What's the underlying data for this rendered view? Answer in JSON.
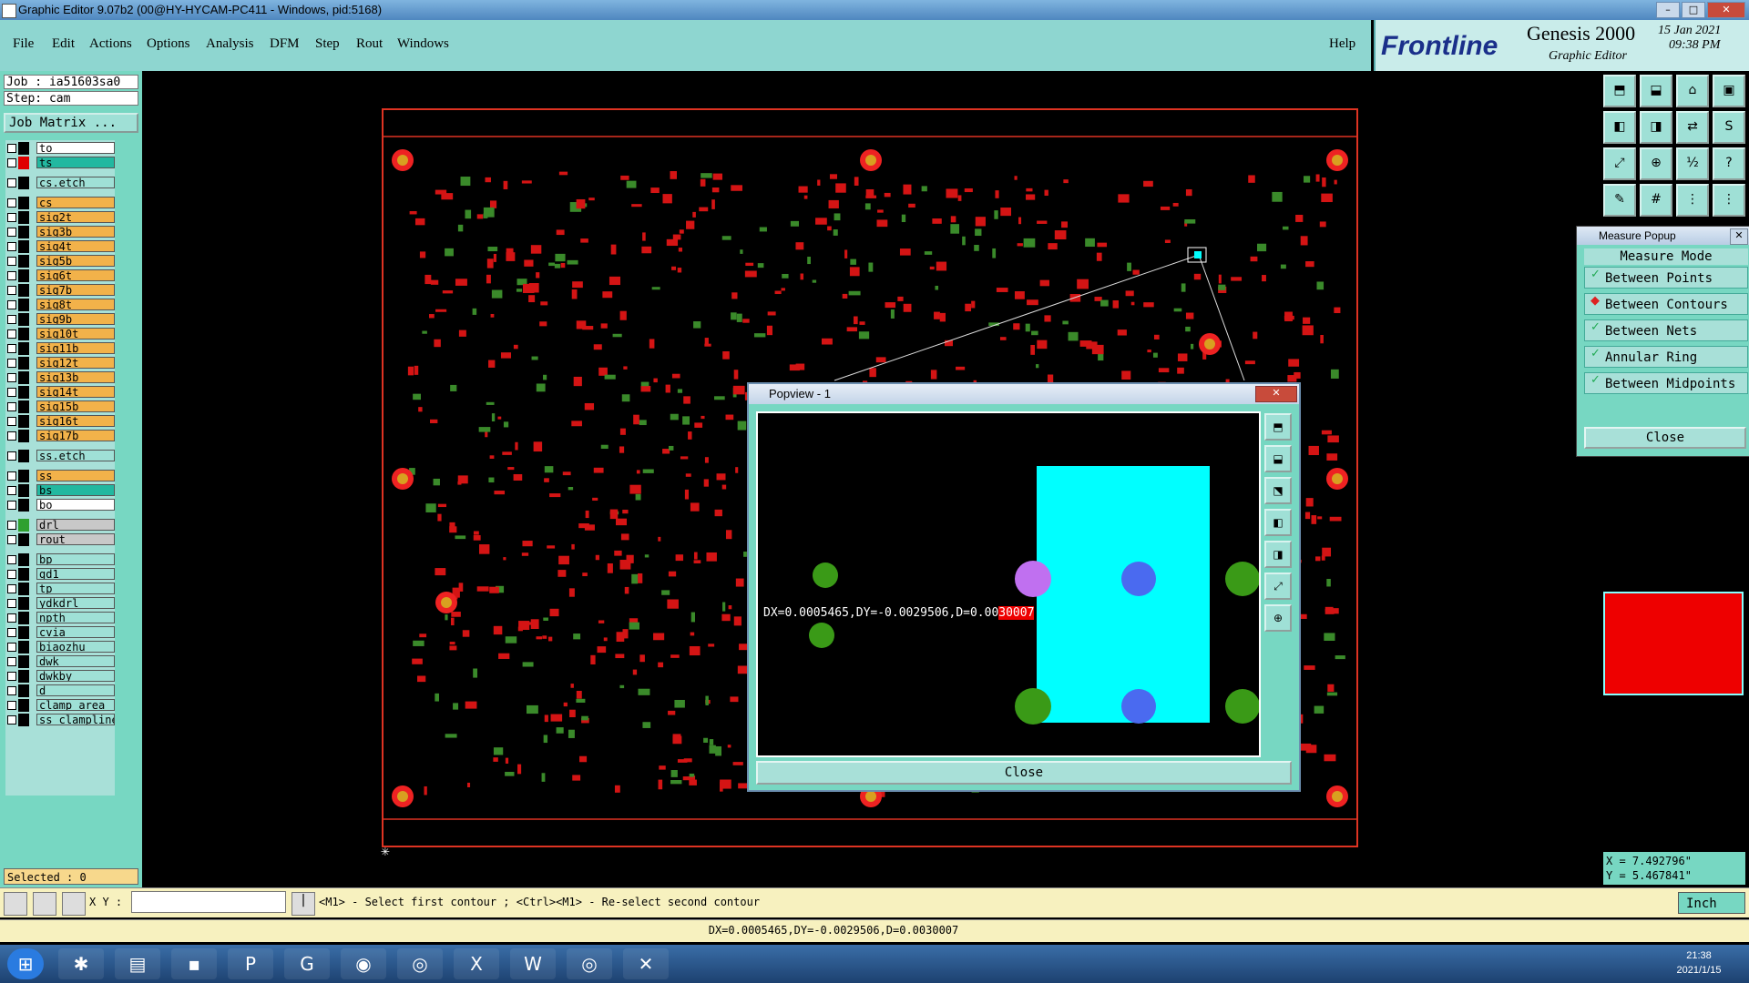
{
  "window": {
    "title": "Graphic Editor 9.07b2 (00@HY-HYCAM-PC411 - Windows, pid:5168)"
  },
  "menu": {
    "items": [
      "File",
      "Edit",
      "Actions",
      "Options",
      "Analysis",
      "DFM",
      "Step",
      "Rout",
      "Windows"
    ],
    "help": "Help"
  },
  "brand": {
    "logo": "Frontline",
    "product": "Genesis 2000",
    "subtitle": "Graphic Editor",
    "date": "15 Jan 2021",
    "time": "09:38 PM"
  },
  "job": {
    "job_line": "Job : ia51603sa0",
    "step_line": "Step: cam",
    "matrix_button": "Job Matrix ..."
  },
  "layers": [
    {
      "name": "to",
      "color": "#ffffff",
      "swatch": "#000000"
    },
    {
      "name": "ts",
      "color": "#22b8a0",
      "swatch": "#e00000"
    },
    {
      "name": "cs.etch",
      "color": "#9fe0d6",
      "swatch": "#000000"
    },
    {
      "name": "cs",
      "color": "#f2b24a",
      "swatch": "#000000"
    },
    {
      "name": "sig2t",
      "color": "#f2b24a",
      "swatch": "#000000"
    },
    {
      "name": "sig3b",
      "color": "#f2b24a",
      "swatch": "#000000"
    },
    {
      "name": "sig4t",
      "color": "#f2b24a",
      "swatch": "#000000"
    },
    {
      "name": "sig5b",
      "color": "#f2b24a",
      "swatch": "#000000"
    },
    {
      "name": "sig6t",
      "color": "#f2b24a",
      "swatch": "#000000"
    },
    {
      "name": "sig7b",
      "color": "#f2b24a",
      "swatch": "#000000"
    },
    {
      "name": "sig8t",
      "color": "#f2b24a",
      "swatch": "#000000"
    },
    {
      "name": "sig9b",
      "color": "#f2b24a",
      "swatch": "#000000"
    },
    {
      "name": "sig10t",
      "color": "#f2b24a",
      "swatch": "#000000"
    },
    {
      "name": "sig11b",
      "color": "#f2b24a",
      "swatch": "#000000"
    },
    {
      "name": "sig12t",
      "color": "#f2b24a",
      "swatch": "#000000"
    },
    {
      "name": "sig13b",
      "color": "#f2b24a",
      "swatch": "#000000"
    },
    {
      "name": "sig14t",
      "color": "#f2b24a",
      "swatch": "#000000"
    },
    {
      "name": "sig15b",
      "color": "#f2b24a",
      "swatch": "#000000"
    },
    {
      "name": "sig16t",
      "color": "#f2b24a",
      "swatch": "#000000"
    },
    {
      "name": "sig17b",
      "color": "#f2b24a",
      "swatch": "#000000"
    },
    {
      "name": "ss.etch",
      "color": "#9fe0d6",
      "swatch": "#000000"
    },
    {
      "name": "ss",
      "color": "#f2b24a",
      "swatch": "#000000"
    },
    {
      "name": "bs",
      "color": "#22b8a0",
      "swatch": "#000000"
    },
    {
      "name": "bo",
      "color": "#ffffff",
      "swatch": "#000000"
    },
    {
      "name": "drl",
      "color": "#c8c8c8",
      "swatch": "#2fa02f"
    },
    {
      "name": "rout",
      "color": "#c8c8c8",
      "swatch": "#000000"
    },
    {
      "name": "bp",
      "color": "#9fe0d6",
      "swatch": "#000000"
    },
    {
      "name": "gd1",
      "color": "#9fe0d6",
      "swatch": "#000000"
    },
    {
      "name": "tp",
      "color": "#9fe0d6",
      "swatch": "#000000"
    },
    {
      "name": "ydkdrl",
      "color": "#9fe0d6",
      "swatch": "#000000"
    },
    {
      "name": "npth",
      "color": "#9fe0d6",
      "swatch": "#000000"
    },
    {
      "name": "cvia",
      "color": "#9fe0d6",
      "swatch": "#000000"
    },
    {
      "name": "biaozhu",
      "color": "#9fe0d6",
      "swatch": "#000000"
    },
    {
      "name": "dwk",
      "color": "#9fe0d6",
      "swatch": "#000000"
    },
    {
      "name": "dwkby",
      "color": "#9fe0d6",
      "swatch": "#000000"
    },
    {
      "name": "d",
      "color": "#9fe0d6",
      "swatch": "#000000"
    },
    {
      "name": "clamp_area",
      "color": "#9fe0d6",
      "swatch": "#000000"
    },
    {
      "name": "ss_clampline",
      "color": "#9fe0d6",
      "swatch": "#000000"
    }
  ],
  "selected": "Selected : 0",
  "measure": {
    "title": "Measure Popup",
    "mode_label": "Measure Mode",
    "options": [
      "Between Points",
      "Between Contours",
      "Between Nets",
      "Annular Ring",
      "Between Midpoints"
    ],
    "close": "Close"
  },
  "popview": {
    "title": "Popview - 1",
    "measurement_prefix": "DX=0.0005465,DY=-0.0029506,D=0.00",
    "measurement_suffix": "30007",
    "close": "Close"
  },
  "coords": {
    "x": "X = 7.492796\"",
    "y": "Y = 5.467841\""
  },
  "command": {
    "xy_label": "X Y :",
    "xy_value": "",
    "prompt": "<M1> - Select first contour ; <Ctrl><M1> - Re-select second contour",
    "units": "Inch"
  },
  "status": {
    "text": "DX=0.0005465,DY=-0.0029506,D=0.0030007"
  },
  "taskbar": {
    "time": "21:38",
    "date": "2021/1/15"
  }
}
